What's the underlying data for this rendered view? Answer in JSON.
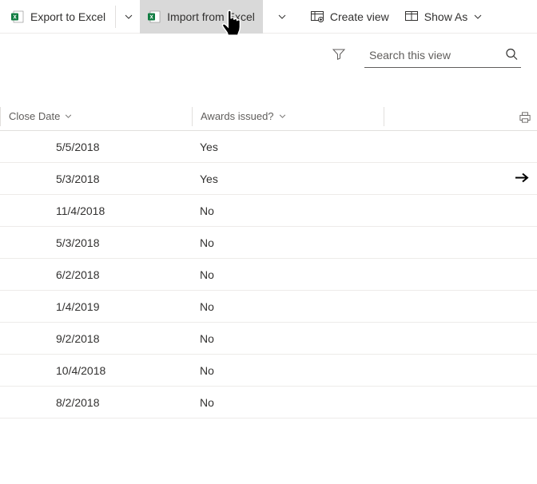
{
  "toolbar": {
    "export_label": "Export to Excel",
    "import_label": "Import from Excel",
    "create_view_label": "Create view",
    "show_as_label": "Show As"
  },
  "search": {
    "placeholder": "Search this view"
  },
  "columns": {
    "close_date": "Close Date",
    "awards_issued": "Awards issued?"
  },
  "rows": [
    {
      "close_date": "5/5/2018",
      "awards": "Yes",
      "selected": false
    },
    {
      "close_date": "5/3/2018",
      "awards": "Yes",
      "selected": true
    },
    {
      "close_date": "11/4/2018",
      "awards": "No",
      "selected": false
    },
    {
      "close_date": "5/3/2018",
      "awards": "No",
      "selected": false
    },
    {
      "close_date": "6/2/2018",
      "awards": "No",
      "selected": false
    },
    {
      "close_date": "1/4/2019",
      "awards": "No",
      "selected": false
    },
    {
      "close_date": "9/2/2018",
      "awards": "No",
      "selected": false
    },
    {
      "close_date": "10/4/2018",
      "awards": "No",
      "selected": false
    },
    {
      "close_date": "8/2/2018",
      "awards": "No",
      "selected": false
    }
  ]
}
